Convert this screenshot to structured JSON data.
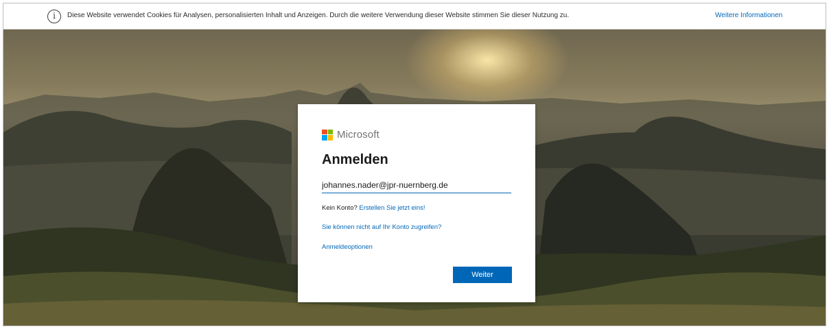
{
  "cookie_banner": {
    "icon": "info-icon",
    "text": "Diese Website verwendet Cookies für Analysen, personalisierten Inhalt und Anzeigen. Durch die weitere Verwendung dieser Website stimmen Sie dieser Nutzung zu.",
    "link": "Weitere Informationen"
  },
  "signin": {
    "brand": "Microsoft",
    "title": "Anmelden",
    "email_value": "johannes.nader@jpr-nuernberg.de",
    "no_account_prefix": "Kein Konto?",
    "create_link": "Erstellen Sie jetzt eins!",
    "cant_access_link": "Sie können nicht auf Ihr Konto zugreifen?",
    "options_link": "Anmeldeoptionen",
    "next_button": "Weiter"
  },
  "colors": {
    "accent": "#0067b8",
    "logo_red": "#f25022",
    "logo_green": "#7fba00",
    "logo_blue": "#00a4ef",
    "logo_yellow": "#ffb900"
  }
}
